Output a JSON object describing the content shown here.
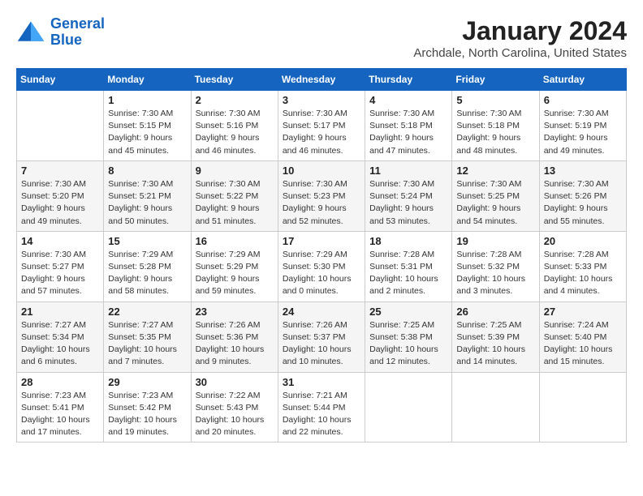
{
  "logo": {
    "line1": "General",
    "line2": "Blue"
  },
  "title": "January 2024",
  "subtitle": "Archdale, North Carolina, United States",
  "days_of_week": [
    "Sunday",
    "Monday",
    "Tuesday",
    "Wednesday",
    "Thursday",
    "Friday",
    "Saturday"
  ],
  "weeks": [
    [
      {
        "day": "",
        "sunrise": "",
        "sunset": "",
        "daylight": ""
      },
      {
        "day": "1",
        "sunrise": "Sunrise: 7:30 AM",
        "sunset": "Sunset: 5:15 PM",
        "daylight": "Daylight: 9 hours and 45 minutes."
      },
      {
        "day": "2",
        "sunrise": "Sunrise: 7:30 AM",
        "sunset": "Sunset: 5:16 PM",
        "daylight": "Daylight: 9 hours and 46 minutes."
      },
      {
        "day": "3",
        "sunrise": "Sunrise: 7:30 AM",
        "sunset": "Sunset: 5:17 PM",
        "daylight": "Daylight: 9 hours and 46 minutes."
      },
      {
        "day": "4",
        "sunrise": "Sunrise: 7:30 AM",
        "sunset": "Sunset: 5:18 PM",
        "daylight": "Daylight: 9 hours and 47 minutes."
      },
      {
        "day": "5",
        "sunrise": "Sunrise: 7:30 AM",
        "sunset": "Sunset: 5:18 PM",
        "daylight": "Daylight: 9 hours and 48 minutes."
      },
      {
        "day": "6",
        "sunrise": "Sunrise: 7:30 AM",
        "sunset": "Sunset: 5:19 PM",
        "daylight": "Daylight: 9 hours and 49 minutes."
      }
    ],
    [
      {
        "day": "7",
        "sunrise": "Sunrise: 7:30 AM",
        "sunset": "Sunset: 5:20 PM",
        "daylight": "Daylight: 9 hours and 49 minutes."
      },
      {
        "day": "8",
        "sunrise": "Sunrise: 7:30 AM",
        "sunset": "Sunset: 5:21 PM",
        "daylight": "Daylight: 9 hours and 50 minutes."
      },
      {
        "day": "9",
        "sunrise": "Sunrise: 7:30 AM",
        "sunset": "Sunset: 5:22 PM",
        "daylight": "Daylight: 9 hours and 51 minutes."
      },
      {
        "day": "10",
        "sunrise": "Sunrise: 7:30 AM",
        "sunset": "Sunset: 5:23 PM",
        "daylight": "Daylight: 9 hours and 52 minutes."
      },
      {
        "day": "11",
        "sunrise": "Sunrise: 7:30 AM",
        "sunset": "Sunset: 5:24 PM",
        "daylight": "Daylight: 9 hours and 53 minutes."
      },
      {
        "day": "12",
        "sunrise": "Sunrise: 7:30 AM",
        "sunset": "Sunset: 5:25 PM",
        "daylight": "Daylight: 9 hours and 54 minutes."
      },
      {
        "day": "13",
        "sunrise": "Sunrise: 7:30 AM",
        "sunset": "Sunset: 5:26 PM",
        "daylight": "Daylight: 9 hours and 55 minutes."
      }
    ],
    [
      {
        "day": "14",
        "sunrise": "Sunrise: 7:30 AM",
        "sunset": "Sunset: 5:27 PM",
        "daylight": "Daylight: 9 hours and 57 minutes."
      },
      {
        "day": "15",
        "sunrise": "Sunrise: 7:29 AM",
        "sunset": "Sunset: 5:28 PM",
        "daylight": "Daylight: 9 hours and 58 minutes."
      },
      {
        "day": "16",
        "sunrise": "Sunrise: 7:29 AM",
        "sunset": "Sunset: 5:29 PM",
        "daylight": "Daylight: 9 hours and 59 minutes."
      },
      {
        "day": "17",
        "sunrise": "Sunrise: 7:29 AM",
        "sunset": "Sunset: 5:30 PM",
        "daylight": "Daylight: 10 hours and 0 minutes."
      },
      {
        "day": "18",
        "sunrise": "Sunrise: 7:28 AM",
        "sunset": "Sunset: 5:31 PM",
        "daylight": "Daylight: 10 hours and 2 minutes."
      },
      {
        "day": "19",
        "sunrise": "Sunrise: 7:28 AM",
        "sunset": "Sunset: 5:32 PM",
        "daylight": "Daylight: 10 hours and 3 minutes."
      },
      {
        "day": "20",
        "sunrise": "Sunrise: 7:28 AM",
        "sunset": "Sunset: 5:33 PM",
        "daylight": "Daylight: 10 hours and 4 minutes."
      }
    ],
    [
      {
        "day": "21",
        "sunrise": "Sunrise: 7:27 AM",
        "sunset": "Sunset: 5:34 PM",
        "daylight": "Daylight: 10 hours and 6 minutes."
      },
      {
        "day": "22",
        "sunrise": "Sunrise: 7:27 AM",
        "sunset": "Sunset: 5:35 PM",
        "daylight": "Daylight: 10 hours and 7 minutes."
      },
      {
        "day": "23",
        "sunrise": "Sunrise: 7:26 AM",
        "sunset": "Sunset: 5:36 PM",
        "daylight": "Daylight: 10 hours and 9 minutes."
      },
      {
        "day": "24",
        "sunrise": "Sunrise: 7:26 AM",
        "sunset": "Sunset: 5:37 PM",
        "daylight": "Daylight: 10 hours and 10 minutes."
      },
      {
        "day": "25",
        "sunrise": "Sunrise: 7:25 AM",
        "sunset": "Sunset: 5:38 PM",
        "daylight": "Daylight: 10 hours and 12 minutes."
      },
      {
        "day": "26",
        "sunrise": "Sunrise: 7:25 AM",
        "sunset": "Sunset: 5:39 PM",
        "daylight": "Daylight: 10 hours and 14 minutes."
      },
      {
        "day": "27",
        "sunrise": "Sunrise: 7:24 AM",
        "sunset": "Sunset: 5:40 PM",
        "daylight": "Daylight: 10 hours and 15 minutes."
      }
    ],
    [
      {
        "day": "28",
        "sunrise": "Sunrise: 7:23 AM",
        "sunset": "Sunset: 5:41 PM",
        "daylight": "Daylight: 10 hours and 17 minutes."
      },
      {
        "day": "29",
        "sunrise": "Sunrise: 7:23 AM",
        "sunset": "Sunset: 5:42 PM",
        "daylight": "Daylight: 10 hours and 19 minutes."
      },
      {
        "day": "30",
        "sunrise": "Sunrise: 7:22 AM",
        "sunset": "Sunset: 5:43 PM",
        "daylight": "Daylight: 10 hours and 20 minutes."
      },
      {
        "day": "31",
        "sunrise": "Sunrise: 7:21 AM",
        "sunset": "Sunset: 5:44 PM",
        "daylight": "Daylight: 10 hours and 22 minutes."
      },
      {
        "day": "",
        "sunrise": "",
        "sunset": "",
        "daylight": ""
      },
      {
        "day": "",
        "sunrise": "",
        "sunset": "",
        "daylight": ""
      },
      {
        "day": "",
        "sunrise": "",
        "sunset": "",
        "daylight": ""
      }
    ]
  ]
}
